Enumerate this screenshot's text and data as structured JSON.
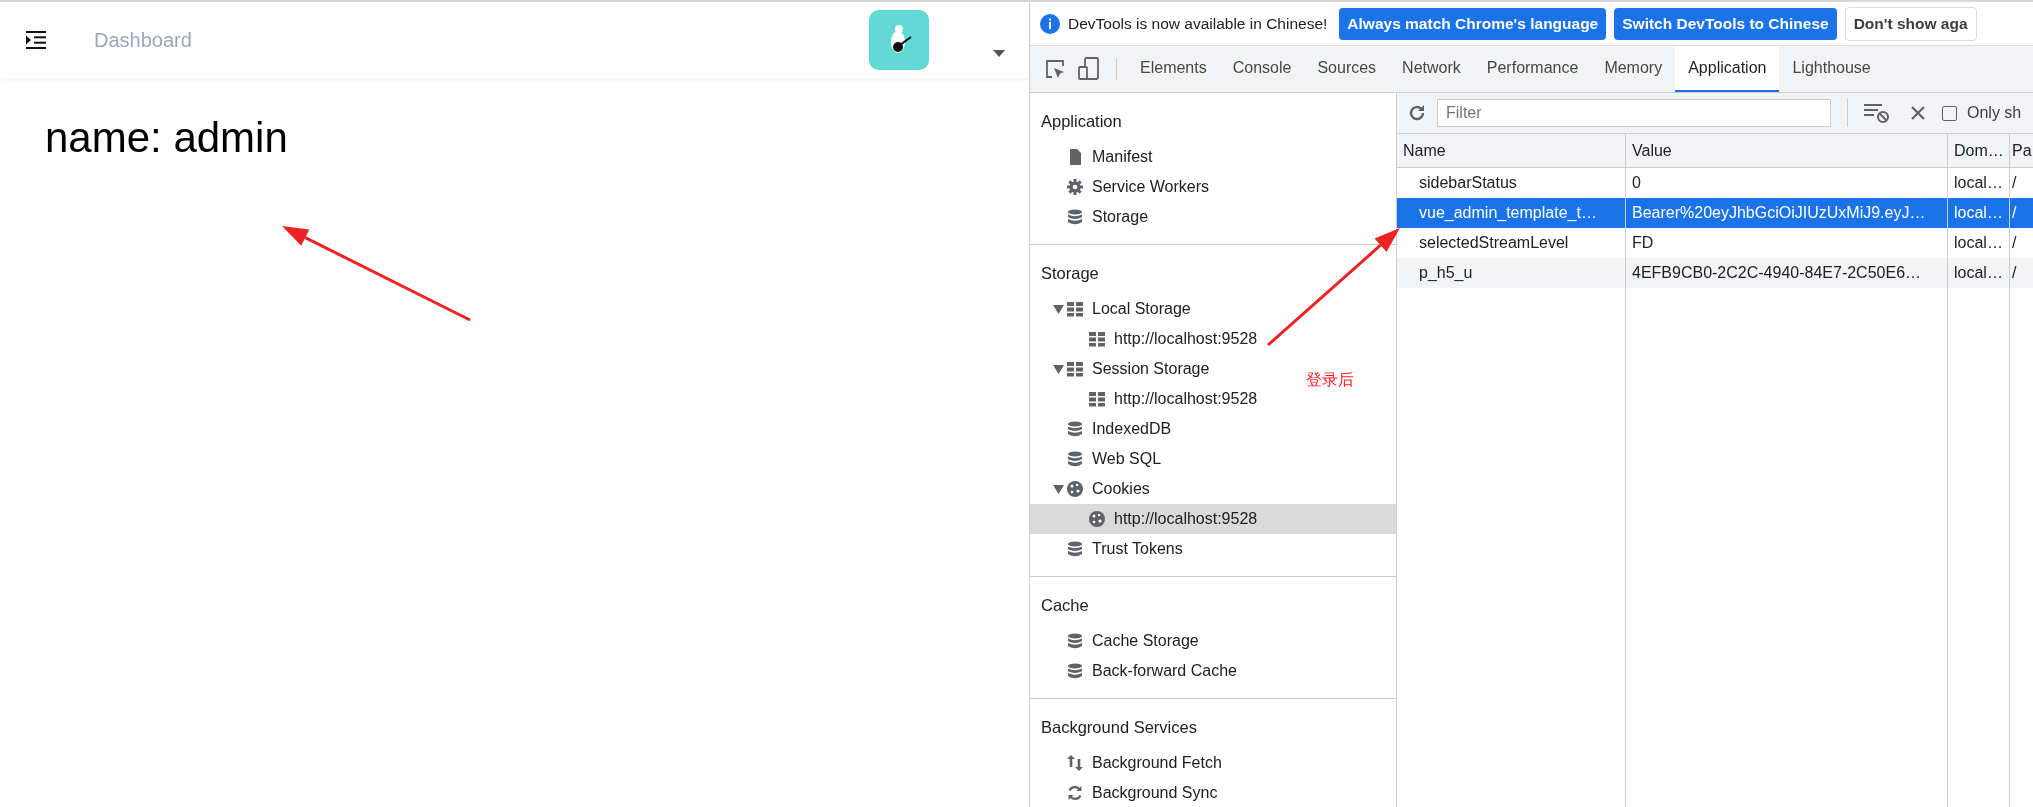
{
  "app": {
    "breadcrumb": "Dashboard",
    "content": "name: admin"
  },
  "devtools": {
    "infobar": {
      "message": "DevTools is now available in Chinese!",
      "buttons": [
        {
          "label": "Always match Chrome's language",
          "kind": "primary"
        },
        {
          "label": "Switch DevTools to Chinese",
          "kind": "primary"
        },
        {
          "label": "Don't show aga",
          "kind": "plain"
        }
      ]
    },
    "tabs": [
      {
        "label": "Elements",
        "selected": false
      },
      {
        "label": "Console",
        "selected": false
      },
      {
        "label": "Sources",
        "selected": false
      },
      {
        "label": "Network",
        "selected": false
      },
      {
        "label": "Performance",
        "selected": false
      },
      {
        "label": "Memory",
        "selected": false
      },
      {
        "label": "Application",
        "selected": true
      },
      {
        "label": "Lighthouse",
        "selected": false
      }
    ],
    "sidebar": {
      "sections": [
        {
          "title": "Application",
          "items": [
            {
              "label": "Manifest",
              "kind": "file",
              "selected": false
            },
            {
              "label": "Service Workers",
              "kind": "gear",
              "selected": false
            },
            {
              "label": "Storage",
              "kind": "database",
              "selected": false
            }
          ]
        },
        {
          "title": "Storage",
          "items": [
            {
              "label": "Local Storage",
              "kind": "grid",
              "selected": false,
              "expanded": true,
              "children": [
                {
                  "label": "http://localhost:9528",
                  "kind": "grid",
                  "selected": false
                }
              ]
            },
            {
              "label": "Session Storage",
              "kind": "grid",
              "selected": false,
              "expanded": true,
              "children": [
                {
                  "label": "http://localhost:9528",
                  "kind": "grid",
                  "selected": false
                }
              ]
            },
            {
              "label": "IndexedDB",
              "kind": "database",
              "selected": false
            },
            {
              "label": "Web SQL",
              "kind": "database",
              "selected": false
            },
            {
              "label": "Cookies",
              "kind": "cookie",
              "selected": false,
              "expanded": true,
              "children": [
                {
                  "label": "http://localhost:9528",
                  "kind": "cookie",
                  "selected": true
                }
              ]
            },
            {
              "label": "Trust Tokens",
              "kind": "database",
              "selected": false
            }
          ]
        },
        {
          "title": "Cache",
          "items": [
            {
              "label": "Cache Storage",
              "kind": "database",
              "selected": false
            },
            {
              "label": "Back-forward Cache",
              "kind": "database",
              "selected": false
            }
          ]
        },
        {
          "title": "Background Services",
          "items": [
            {
              "label": "Background Fetch",
              "kind": "updown",
              "selected": false
            },
            {
              "label": "Background Sync",
              "kind": "sync",
              "selected": false
            }
          ]
        }
      ]
    },
    "toolbar": {
      "filter_placeholder": "Filter",
      "checkbox_label": "Only sh",
      "checked": false
    },
    "table": {
      "columns": [
        "Name",
        "Value",
        "Dom…",
        "Pa"
      ],
      "rows": [
        {
          "cells": [
            "sidebarStatus",
            "0",
            "local…",
            "/"
          ],
          "selected": false
        },
        {
          "cells": [
            "vue_admin_template_t…",
            "Bearer%20eyJhbGciOiJIUzUxMiJ9.eyJ…",
            "local…",
            "/"
          ],
          "selected": true
        },
        {
          "cells": [
            "selectedStreamLevel",
            "FD",
            "local…",
            "/"
          ],
          "selected": false
        },
        {
          "cells": [
            "p_h5_u",
            "4EFB9CB0-2C2C-4940-84E7-2C50E6…",
            "local…",
            "/"
          ],
          "selected": false
        }
      ]
    }
  },
  "annotations": [
    {
      "kind": "arrow"
    },
    {
      "kind": "arrow"
    },
    {
      "kind": "note",
      "text": "登录后"
    }
  ]
}
